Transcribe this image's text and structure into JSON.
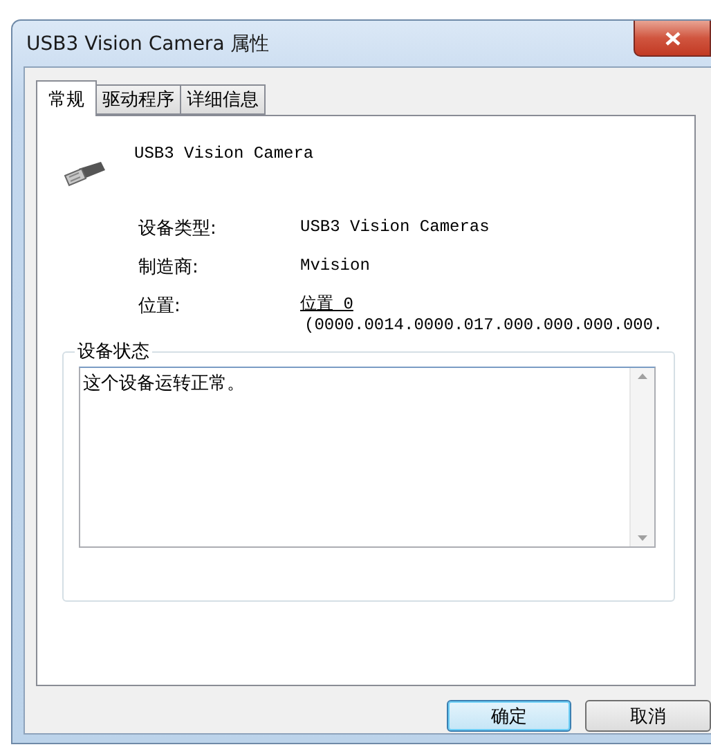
{
  "window": {
    "title": "USB3 Vision Camera 属性"
  },
  "tabs": [
    {
      "label": "常规",
      "selected": true
    },
    {
      "label": "驱动程序",
      "selected": false
    },
    {
      "label": "详细信息",
      "selected": false
    }
  ],
  "device": {
    "name": "USB3 Vision Camera"
  },
  "properties": [
    {
      "label": "设备类型:",
      "lines": [
        "USB3 Vision Cameras"
      ]
    },
    {
      "label": "制造商:",
      "lines": [
        "Mvision"
      ]
    },
    {
      "label": "位置:",
      "lines": [
        "位置 0",
        "(0000.0014.0000.017.000.000.000.000."
      ]
    }
  ],
  "status": {
    "legend": "设备状态",
    "text": "这个设备运转正常。"
  },
  "buttons": [
    {
      "label": "确定",
      "default": true
    },
    {
      "label": "取消",
      "default": false
    }
  ]
}
